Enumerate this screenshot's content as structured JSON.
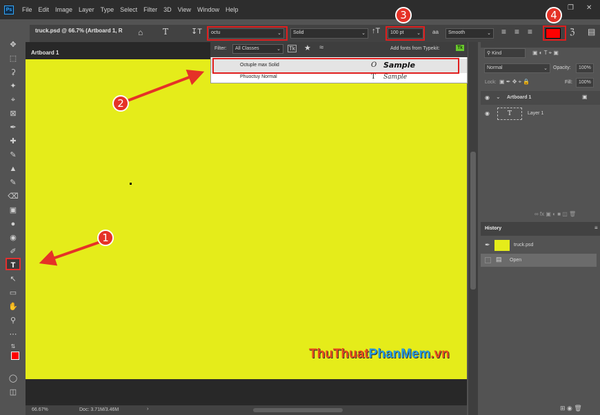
{
  "app": {
    "logo": "Ps"
  },
  "menu": [
    "File",
    "Edit",
    "Image",
    "Layer",
    "Type",
    "Select",
    "Filter",
    "3D",
    "View",
    "Window",
    "Help"
  ],
  "document": {
    "tab_title": "truck.psd @ 66.7% (Artboard 1, R",
    "artboard_label": "Artboard 1"
  },
  "options": {
    "font_family_value": "octu",
    "font_style_value": "Solid",
    "font_size_value": "100 pt",
    "aa_value": "Smooth",
    "text_color": "#ff0000"
  },
  "font_dropdown": {
    "filter_label": "Filter:",
    "filter_value": "All Classes",
    "typekit_label": "Add fonts from Typekit:",
    "typekit_badge": "Tk",
    "fonts": [
      {
        "name": "Octuple max Solid",
        "type_glyph": "O",
        "sample": "Sample"
      },
      {
        "name": "Phuoctuy Normal",
        "type_glyph": "T",
        "sample": "Sample"
      }
    ]
  },
  "annotations": {
    "one": "1",
    "two": "2",
    "three": "3",
    "four": "4"
  },
  "watermark": {
    "part1": "ThuThuat",
    "part2": "PhanMem",
    "part3": ".vn",
    "color1": "#e84d1c",
    "color2": "#2a9bdc"
  },
  "status": {
    "zoom": "66.67%",
    "doc": "Doc: 3.71M/3.46M"
  },
  "layers_panel": {
    "search_placeholder": "Kind",
    "blend_mode": "Normal",
    "opacity_label": "Opacity:",
    "opacity_value": "100%",
    "lock_label": "Lock:",
    "fill_label": "Fill:",
    "fill_value": "100%",
    "artboard_name": "Artboard 1",
    "layer_name": "Layer 1"
  },
  "history_panel": {
    "title": "History",
    "snapshot_name": "truck.psd",
    "step_name": "Open"
  },
  "colors": {
    "artboard": "#e5ec1a",
    "highlight_red": "#e01e1e"
  }
}
